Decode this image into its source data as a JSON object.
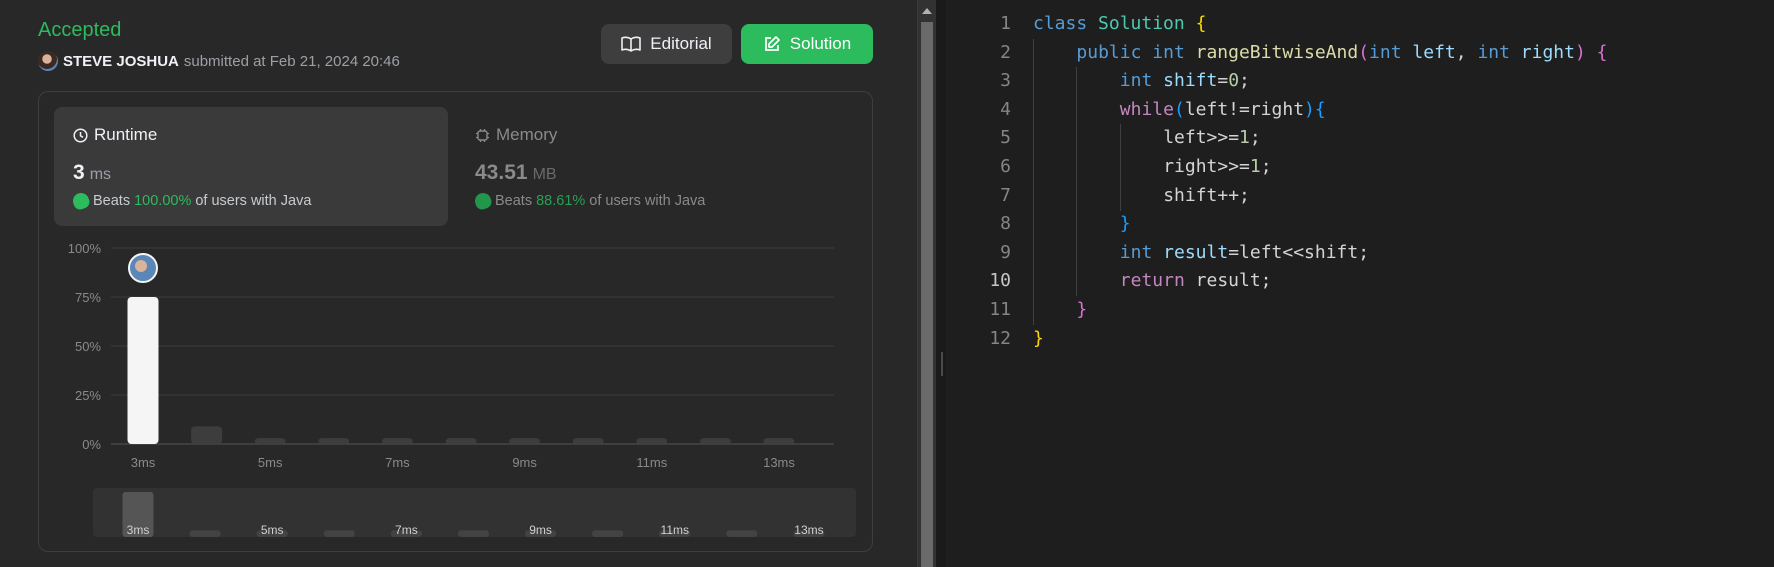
{
  "submission": {
    "status": "Accepted",
    "user": "STEVE JOSHUA",
    "submitted_text": "submitted at Feb 21, 2024 20:46"
  },
  "buttons": {
    "editorial": "Editorial",
    "solution": "Solution"
  },
  "runtime": {
    "label": "Runtime",
    "value": "3",
    "unit": "ms",
    "beats_prefix": "Beats",
    "beats_pct": "100.00%",
    "beats_suffix": "of users with Java"
  },
  "memory": {
    "label": "Memory",
    "value": "43.51",
    "unit": "MB",
    "beats_prefix": "Beats",
    "beats_pct": "88.61%",
    "beats_suffix": "of users with Java"
  },
  "colors": {
    "accent_green": "#2cbb5d",
    "panel_bg": "#282828",
    "editor_bg": "#1e1e1e"
  },
  "chart_data": {
    "type": "bar",
    "ylim": [
      0,
      100
    ],
    "y_ticks": [
      "100%",
      "75%",
      "50%",
      "25%",
      "0%"
    ],
    "y_tick_values": [
      100,
      75,
      50,
      25,
      0
    ],
    "values": [
      75,
      9,
      3,
      3,
      3,
      3,
      3,
      3,
      3,
      3,
      3
    ],
    "highlight_index": 0,
    "x_labels": [
      "3ms",
      "5ms",
      "7ms",
      "9ms",
      "11ms",
      "13ms"
    ],
    "x_label_indices": [
      0,
      2,
      4,
      6,
      8,
      10
    ],
    "grid": true,
    "minimap": {
      "values": [
        100,
        15,
        15,
        15,
        15,
        15,
        15,
        15,
        15,
        15,
        15
      ],
      "x_labels": [
        "3ms",
        "5ms",
        "7ms",
        "9ms",
        "11ms",
        "13ms"
      ]
    }
  },
  "editor": {
    "active_line": 10,
    "lines": [
      {
        "n": "1",
        "indent": 0,
        "tokens": [
          [
            "kw",
            "class"
          ],
          [
            "pn",
            " "
          ],
          [
            "type",
            "Solution"
          ],
          [
            "pn",
            " "
          ],
          [
            "br1",
            "{"
          ]
        ]
      },
      {
        "n": "2",
        "indent": 1,
        "tokens": [
          [
            "kw",
            "public"
          ],
          [
            "pn",
            " "
          ],
          [
            "kw",
            "int"
          ],
          [
            "pn",
            " "
          ],
          [
            "fn",
            "rangeBitwiseAnd"
          ],
          [
            "br2",
            "("
          ],
          [
            "kw",
            "int"
          ],
          [
            "pn",
            " "
          ],
          [
            "var",
            "left"
          ],
          [
            "pn",
            ", "
          ],
          [
            "kw",
            "int"
          ],
          [
            "pn",
            " "
          ],
          [
            "var",
            "right"
          ],
          [
            "br2",
            ")"
          ],
          [
            "pn",
            " "
          ],
          [
            "br2",
            "{"
          ]
        ]
      },
      {
        "n": "3",
        "indent": 2,
        "tokens": [
          [
            "kw",
            "int"
          ],
          [
            "pn",
            " "
          ],
          [
            "var",
            "shift"
          ],
          [
            "pn",
            "="
          ],
          [
            "num",
            "0"
          ],
          [
            "pn",
            ";"
          ]
        ]
      },
      {
        "n": "4",
        "indent": 2,
        "tokens": [
          [
            "ctl",
            "while"
          ],
          [
            "br3",
            "("
          ],
          [
            "pn",
            "left!=right"
          ],
          [
            "br3",
            ")"
          ],
          [
            "br3",
            "{"
          ]
        ]
      },
      {
        "n": "5",
        "indent": 3,
        "tokens": [
          [
            "pn",
            "left>>="
          ],
          [
            "num",
            "1"
          ],
          [
            "pn",
            ";"
          ]
        ]
      },
      {
        "n": "6",
        "indent": 3,
        "tokens": [
          [
            "pn",
            "right>>="
          ],
          [
            "num",
            "1"
          ],
          [
            "pn",
            ";"
          ]
        ]
      },
      {
        "n": "7",
        "indent": 3,
        "tokens": [
          [
            "pn",
            "shift++;"
          ]
        ]
      },
      {
        "n": "8",
        "indent": 2,
        "tokens": [
          [
            "br3",
            "}"
          ]
        ]
      },
      {
        "n": "9",
        "indent": 2,
        "tokens": [
          [
            "kw",
            "int"
          ],
          [
            "pn",
            " "
          ],
          [
            "var",
            "result"
          ],
          [
            "pn",
            "=left<<shift;"
          ]
        ]
      },
      {
        "n": "10",
        "indent": 2,
        "tokens": [
          [
            "ctl",
            "return"
          ],
          [
            "pn",
            " result;"
          ]
        ]
      },
      {
        "n": "11",
        "indent": 1,
        "tokens": [
          [
            "br2",
            "}"
          ]
        ]
      },
      {
        "n": "12",
        "indent": 0,
        "tokens": [
          [
            "br1",
            "}"
          ]
        ]
      }
    ]
  }
}
